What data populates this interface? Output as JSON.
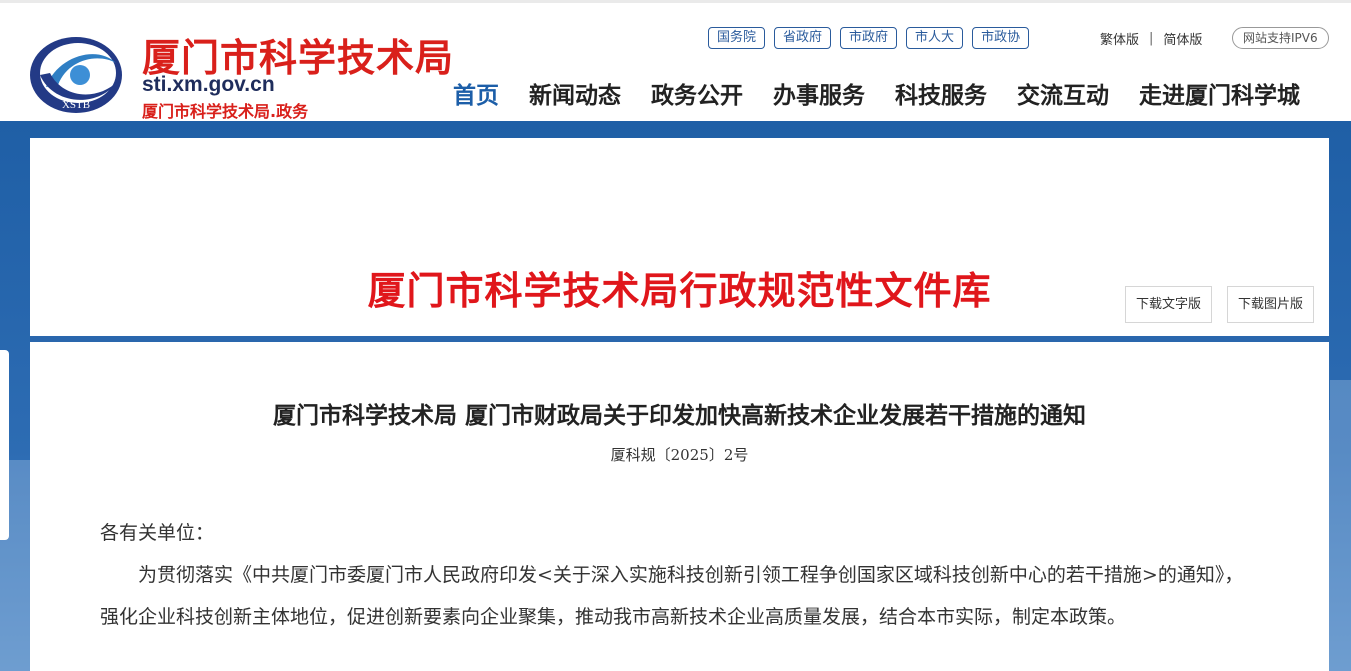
{
  "header": {
    "logo_text": "XSTB",
    "site_name": "厦门市科学技术局",
    "domain": "sti.xm.gov.cn",
    "subtitle": "厦门市科学技术局.政务",
    "top_links": [
      "国务院",
      "省政府",
      "市政府",
      "市人大",
      "市政协"
    ],
    "lang_traditional": "繁体版",
    "lang_separator": "|",
    "lang_simplified": "简体版",
    "ipv6_label": "网站支持IPV6"
  },
  "nav": {
    "items": [
      "首页",
      "新闻动态",
      "政务公开",
      "办事服务",
      "科技服务",
      "交流互动",
      "走进厦门科学城"
    ],
    "active_index": 0
  },
  "banner": {
    "title": "厦门市科学技术局行政规范性文件库",
    "download_text": "下载文字版",
    "download_image": "下载图片版"
  },
  "document": {
    "title": "厦门市科学技术局 厦门市财政局关于印发加快高新技术企业发展若干措施的通知",
    "number": "厦科规〔2025〕2号",
    "salutation": "各有关单位：",
    "paragraph1": "为贯彻落实《中共厦门市委厦门市人民政府印发<关于深入实施科技创新引领工程争创国家区域科技创新中心的若干措施>的通知》，强化企业科技创新主体地位，促进创新要素向企业聚集，推动我市高新技术企业高质量发展，结合本市实际，制定本政策。"
  },
  "colors": {
    "brand_red": "#d9201b",
    "brand_blue": "#1c5ea8",
    "background_blue": "#1f5fa6"
  }
}
